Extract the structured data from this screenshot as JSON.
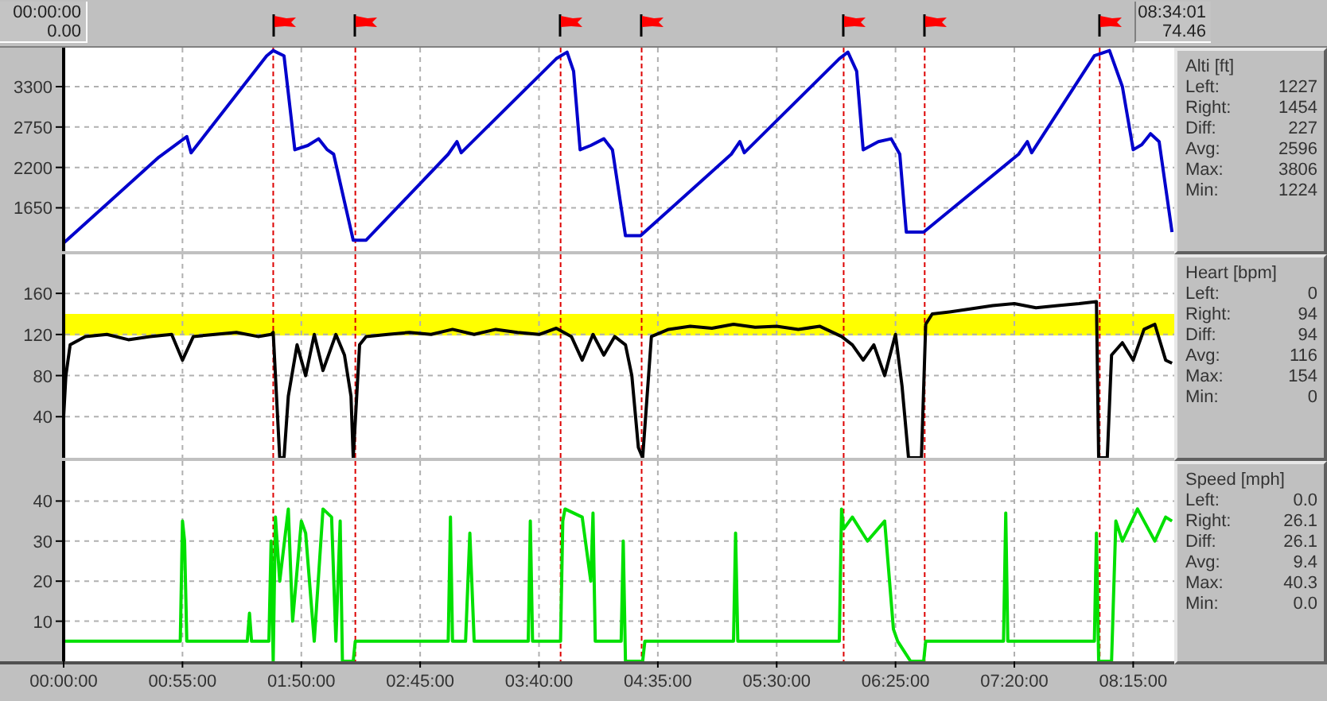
{
  "time_range": {
    "start_time": "00:00:00",
    "start_distance": "0.00",
    "end_time": "08:34:01",
    "end_distance": "74.46"
  },
  "panels": [
    {
      "stats": {
        "title": "Alti [ft]",
        "rows": [
          {
            "label": "Left:",
            "value": "1227"
          },
          {
            "label": "Right:",
            "value": "1454"
          },
          {
            "label": "Diff:",
            "value": "227"
          },
          {
            "label": "Avg:",
            "value": "2596"
          },
          {
            "label": "Max:",
            "value": "3806"
          },
          {
            "label": "Min:",
            "value": "1224"
          }
        ]
      },
      "chart_data": {
        "type": "line",
        "grid": true,
        "xlim": [
          0,
          514
        ],
        "ylim": [
          1060,
          3830
        ],
        "yticks": [
          1650,
          2200,
          2750,
          3300
        ],
        "x": [
          0,
          44,
          57,
          59,
          94,
          97,
          102,
          107,
          113,
          118,
          122,
          125,
          134,
          140,
          178,
          182,
          184,
          228,
          233,
          236,
          239,
          244,
          250,
          254,
          260,
          267,
          309,
          313,
          315,
          359,
          363,
          367,
          370,
          377,
          383,
          387,
          390,
          398,
          442,
          446,
          448,
          477,
          484,
          490,
          495,
          499,
          503,
          507,
          513
        ],
        "series": [
          {
            "color": "#0000cc",
            "values": [
              1170,
              2340,
              2620,
              2400,
              3720,
              3790,
              3720,
              2440,
              2500,
              2590,
              2440,
              2380,
              1210,
              1210,
              2380,
              2550,
              2400,
              3680,
              3770,
              3510,
              2440,
              2500,
              2590,
              2440,
              1270,
              1270,
              2380,
              2550,
              2400,
              3680,
              3770,
              3510,
              2440,
              2550,
              2590,
              2380,
              1320,
              1320,
              2380,
              2550,
              2400,
              3720,
              3790,
              3300,
              2440,
              2510,
              2660,
              2550,
              1320
            ]
          }
        ],
        "ref_lines": [
          {
            "axis": "x",
            "value": 97
          },
          {
            "axis": "x",
            "value": 135
          },
          {
            "axis": "x",
            "value": 230
          },
          {
            "axis": "x",
            "value": 267.5
          },
          {
            "axis": "x",
            "value": 361
          },
          {
            "axis": "x",
            "value": 398.5
          },
          {
            "axis": "x",
            "value": 479.5
          }
        ]
      }
    },
    {
      "stats": {
        "title": "Heart [bpm]",
        "rows": [
          {
            "label": "Left:",
            "value": "0"
          },
          {
            "label": "Right:",
            "value": "94"
          },
          {
            "label": "Diff:",
            "value": "94"
          },
          {
            "label": "Avg:",
            "value": "116"
          },
          {
            "label": "Max:",
            "value": "154"
          },
          {
            "label": "Min:",
            "value": "0"
          }
        ]
      },
      "chart_data": {
        "type": "line",
        "grid": true,
        "xlim": [
          0,
          514
        ],
        "ylim": [
          0,
          198
        ],
        "yticks": [
          40,
          80,
          120,
          160
        ],
        "x": [
          0,
          1,
          3,
          10,
          20,
          30,
          40,
          50,
          55,
          60,
          70,
          80,
          90,
          96,
          97,
          100,
          102,
          104,
          108,
          112,
          116,
          120,
          126,
          130,
          133,
          134,
          137,
          140,
          150,
          160,
          170,
          180,
          190,
          200,
          210,
          220,
          228,
          235,
          240,
          245,
          250,
          255,
          260,
          263,
          266,
          268,
          272,
          280,
          290,
          300,
          310,
          320,
          330,
          340,
          350,
          360,
          365,
          370,
          375,
          380,
          385,
          388,
          391,
          397,
          399,
          402,
          410,
          420,
          430,
          440,
          450,
          460,
          470,
          478,
          479,
          483,
          485,
          490,
          495,
          500,
          505,
          510,
          513
        ],
        "series": [
          {
            "color": "#000000",
            "values": [
              40,
              80,
              110,
              118,
              120,
              115,
              118,
              120,
              95,
              118,
              120,
              122,
              118,
              120,
              122,
              0,
              0,
              60,
              110,
              80,
              120,
              85,
              120,
              100,
              60,
              0,
              110,
              118,
              120,
              122,
              120,
              125,
              120,
              125,
              122,
              120,
              126,
              118,
              95,
              120,
              100,
              118,
              110,
              80,
              10,
              0,
              118,
              125,
              128,
              126,
              130,
              127,
              128,
              125,
              128,
              118,
              110,
              95,
              110,
              80,
              120,
              70,
              0,
              0,
              130,
              140,
              142,
              145,
              148,
              150,
              146,
              148,
              150,
              152,
              0,
              0,
              100,
              112,
              95,
              125,
              130,
              95,
              92
            ]
          }
        ],
        "bands": [
          {
            "axis": "y",
            "from": 119,
            "to": 140,
            "color": "#ffff00"
          }
        ],
        "ref_lines": [
          {
            "axis": "x",
            "value": 97
          },
          {
            "axis": "x",
            "value": 135
          },
          {
            "axis": "x",
            "value": 230
          },
          {
            "axis": "x",
            "value": 267.5
          },
          {
            "axis": "x",
            "value": 361
          },
          {
            "axis": "x",
            "value": 398.5
          },
          {
            "axis": "x",
            "value": 479.5
          }
        ]
      }
    },
    {
      "stats": {
        "title": "Speed [mph]",
        "rows": [
          {
            "label": "Left:",
            "value": "0.0"
          },
          {
            "label": "Right:",
            "value": "26.1"
          },
          {
            "label": "Diff:",
            "value": "26.1"
          },
          {
            "label": "Avg:",
            "value": "9.4"
          },
          {
            "label": "Max:",
            "value": "40.3"
          },
          {
            "label": "Min:",
            "value": "0.0"
          }
        ]
      },
      "chart_data": {
        "type": "line",
        "grid": true,
        "xlim": [
          0,
          514
        ],
        "ylim": [
          0,
          50
        ],
        "yticks": [
          10,
          20,
          30,
          40
        ],
        "xticks": [
          {
            "value": 0,
            "label": "00:00:00"
          },
          {
            "value": 55,
            "label": "00:55:00"
          },
          {
            "value": 110,
            "label": "01:50:00"
          },
          {
            "value": 165,
            "label": "02:45:00"
          },
          {
            "value": 220,
            "label": "03:40:00"
          },
          {
            "value": 275,
            "label": "04:35:00"
          },
          {
            "value": 330,
            "label": "05:30:00"
          },
          {
            "value": 385,
            "label": "06:25:00"
          },
          {
            "value": 440,
            "label": "07:20:00"
          },
          {
            "value": 495,
            "label": "08:15:00"
          }
        ],
        "x": [
          0,
          54,
          55,
          56,
          57,
          85,
          86,
          87,
          95,
          96,
          97,
          98,
          100,
          104,
          106,
          110,
          112,
          116,
          120,
          124,
          126,
          128,
          129,
          130,
          134,
          135,
          140,
          178,
          179,
          180,
          186,
          188,
          190,
          200,
          215,
          216,
          217,
          230,
          231,
          232,
          240,
          244,
          245,
          246,
          258,
          259,
          260,
          268,
          269,
          270,
          300,
          310,
          311,
          312,
          350,
          359,
          360,
          361,
          365,
          372,
          380,
          384,
          386,
          392,
          393,
          398,
          399,
          400,
          420,
          435,
          436,
          437,
          445,
          460,
          470,
          477,
          478,
          479,
          485,
          487,
          490,
          497,
          500,
          505,
          510,
          513
        ],
        "series": [
          {
            "color": "#00e000",
            "values": [
              5,
              5,
              35,
              30,
              5,
              5,
              12,
              5,
              5,
              30,
              0,
              36,
              20,
              38,
              10,
              35,
              32,
              5,
              38,
              36,
              5,
              35,
              0,
              0,
              0,
              5,
              5,
              5,
              36,
              5,
              5,
              32,
              5,
              5,
              5,
              35,
              5,
              5,
              35,
              38,
              36,
              20,
              37,
              5,
              5,
              30,
              0,
              0,
              5,
              5,
              5,
              5,
              32,
              5,
              5,
              5,
              38,
              33,
              36,
              30,
              35,
              8,
              5,
              0,
              0,
              0,
              5,
              5,
              5,
              5,
              37,
              5,
              5,
              5,
              5,
              5,
              32,
              0,
              0,
              35,
              30,
              38,
              35,
              30,
              36,
              35
            ]
          }
        ],
        "ref_lines": [
          {
            "axis": "x",
            "value": 97
          },
          {
            "axis": "x",
            "value": 135
          },
          {
            "axis": "x",
            "value": 230
          },
          {
            "axis": "x",
            "value": 267.5
          },
          {
            "axis": "x",
            "value": 361
          },
          {
            "axis": "x",
            "value": 398.5
          },
          {
            "axis": "x",
            "value": 479.5
          }
        ]
      }
    }
  ]
}
